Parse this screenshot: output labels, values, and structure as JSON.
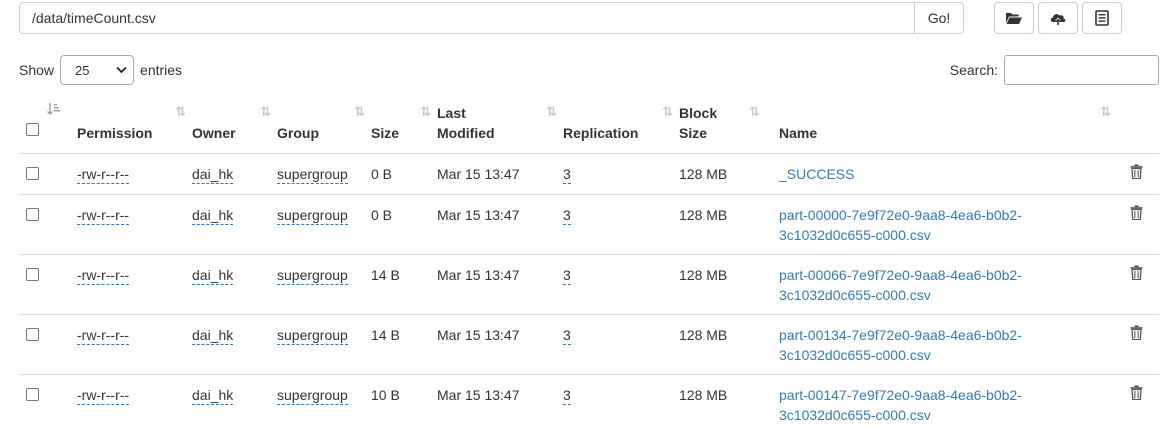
{
  "pathbar": {
    "path_value": "/data/timeCount.csv",
    "go_label": "Go!"
  },
  "toolbar": {
    "icons": [
      "folder-open-icon",
      "cloud-upload-icon",
      "list-alt-icon"
    ]
  },
  "controls": {
    "show_label": "Show",
    "entries_value": "25",
    "entries_label": "entries",
    "search_label": "Search:",
    "search_value": ""
  },
  "table": {
    "columns": {
      "permission": "Permission",
      "owner": "Owner",
      "group": "Group",
      "size": "Size",
      "last_modified_1": "Last",
      "last_modified_2": "Modified",
      "replication": "Replication",
      "block_size_1": "Block",
      "block_size_2": "Size",
      "name": "Name"
    },
    "rows": [
      {
        "permission": "-rw-r--r--",
        "owner": "dai_hk",
        "group": "supergroup",
        "size": "0 B",
        "modified": "Mar 15 13:47",
        "replication": "3",
        "block_size": "128 MB",
        "name_1": "_SUCCESS",
        "name_2": ""
      },
      {
        "permission": "-rw-r--r--",
        "owner": "dai_hk",
        "group": "supergroup",
        "size": "0 B",
        "modified": "Mar 15 13:47",
        "replication": "3",
        "block_size": "128 MB",
        "name_1": "part-00000-7e9f72e0-9aa8-4ea6-b0b2-",
        "name_2": "3c1032d0c655-c000.csv"
      },
      {
        "permission": "-rw-r--r--",
        "owner": "dai_hk",
        "group": "supergroup",
        "size": "14 B",
        "modified": "Mar 15 13:47",
        "replication": "3",
        "block_size": "128 MB",
        "name_1": "part-00066-7e9f72e0-9aa8-4ea6-b0b2-",
        "name_2": "3c1032d0c655-c000.csv"
      },
      {
        "permission": "-rw-r--r--",
        "owner": "dai_hk",
        "group": "supergroup",
        "size": "14 B",
        "modified": "Mar 15 13:47",
        "replication": "3",
        "block_size": "128 MB",
        "name_1": "part-00134-7e9f72e0-9aa8-4ea6-b0b2-",
        "name_2": "3c1032d0c655-c000.csv"
      },
      {
        "permission": "-rw-r--r--",
        "owner": "dai_hk",
        "group": "supergroup",
        "size": "10 B",
        "modified": "Mar 15 13:47",
        "replication": "3",
        "block_size": "128 MB",
        "name_1": "part-00147-7e9f72e0-9aa8-4ea6-b0b2-",
        "name_2": "3c1032d0c655-c000.csv"
      }
    ]
  }
}
